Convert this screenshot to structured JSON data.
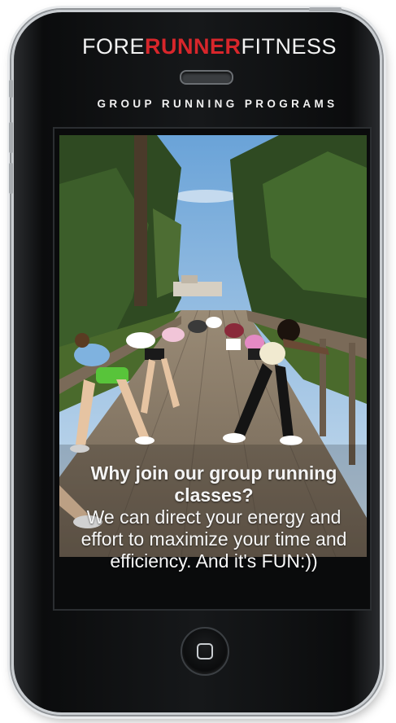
{
  "brand": {
    "part1": "FORE",
    "part2": "RUNNER",
    "part3": "FITNESS"
  },
  "subtitle": "GROUP RUNNING PROGRAMS",
  "caption": {
    "heading": "Why join our group running classes?",
    "body": "We can direct your energy and effort to maximize your time and efficiency. And it's FUN:))"
  },
  "icons": {
    "home_button": "home-square-icon",
    "speaker": "speaker-slot"
  },
  "colors": {
    "brand_red": "#d8262b",
    "text": "#f2f2f2",
    "phone_body": "#0b0c0d"
  }
}
